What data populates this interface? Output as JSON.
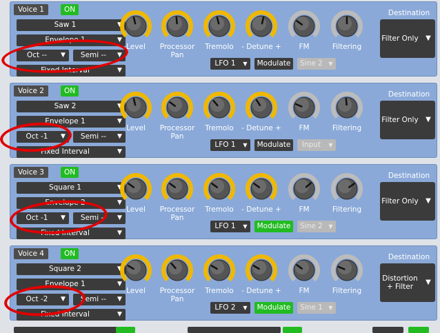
{
  "voices": [
    {
      "title": "Voice 1",
      "on": "ON",
      "wave": "Saw 1",
      "envelope": "Envelope 1",
      "oct": "Oct --",
      "semi": "Semi --",
      "interval": "Fixed Interval",
      "knobs": [
        {
          "label": "Level",
          "type": "gold",
          "level": 0.45
        },
        {
          "label": "Processor Pan",
          "type": "gold",
          "level": 0.48
        },
        {
          "label": "Tremolo",
          "type": "gold",
          "level": 0.45
        },
        {
          "label": "- Detune +",
          "type": "gold",
          "level": 0.55
        },
        {
          "label": "FM",
          "type": "grey",
          "level": 0.3
        },
        {
          "label": "Filtering",
          "type": "grey",
          "level": 0.5
        }
      ],
      "lfo": "LFO 1",
      "modulate": "Modulate",
      "modulate_active": false,
      "fm_source": "Sine 2",
      "destination_title": "Destination",
      "destination": "Filter Only"
    },
    {
      "title": "Voice 2",
      "on": "ON",
      "wave": "Saw 2",
      "envelope": "Envelope 1",
      "oct": "Oct -1",
      "semi": "Semi --",
      "interval": "Fixed Interval",
      "knobs": [
        {
          "label": "Level",
          "type": "gold",
          "level": 0.45
        },
        {
          "label": "Processor Pan",
          "type": "gold",
          "level": 0.3
        },
        {
          "label": "Tremolo",
          "type": "gold",
          "level": 0.35
        },
        {
          "label": "- Detune +",
          "type": "gold",
          "level": 0.38
        },
        {
          "label": "FM",
          "type": "grey",
          "level": 0.25
        },
        {
          "label": "Filtering",
          "type": "grey",
          "level": 0.48
        }
      ],
      "lfo": "LFO 1",
      "modulate": "Modulate",
      "modulate_active": false,
      "fm_source": "Input",
      "destination_title": "Destination",
      "destination": "Filter Only"
    },
    {
      "title": "Voice 3",
      "on": "ON",
      "wave": "Square 1",
      "envelope": "Envelope 2",
      "oct": "Oct -1",
      "semi": "Semi --",
      "interval": "Fixed Interval",
      "knobs": [
        {
          "label": "Level",
          "type": "gold",
          "level": 0.3
        },
        {
          "label": "Processor Pan",
          "type": "gold",
          "level": 0.3
        },
        {
          "label": "Tremolo",
          "type": "gold",
          "level": 0.3
        },
        {
          "label": "- Detune +",
          "type": "gold",
          "level": 0.3
        },
        {
          "label": "FM",
          "type": "grey",
          "level": 0.68
        },
        {
          "label": "Filtering",
          "type": "grey",
          "level": 0.7
        }
      ],
      "lfo": "LFO 1",
      "modulate": "Modulate",
      "modulate_active": true,
      "fm_source": "Sine 2",
      "destination_title": "Destination",
      "destination": "Filter Only"
    },
    {
      "title": "Voice 4",
      "on": "ON",
      "wave": "Square 2",
      "envelope": "Envelope 1",
      "oct": "Oct -2",
      "semi": "Semi --",
      "interval": "Fixed Interval",
      "knobs": [
        {
          "label": "Level",
          "type": "gold",
          "level": 0.28
        },
        {
          "label": "Processor Pan",
          "type": "gold",
          "level": 0.35
        },
        {
          "label": "Tremolo",
          "type": "gold",
          "level": 0.28
        },
        {
          "label": "- Detune +",
          "type": "gold",
          "level": 0.28
        },
        {
          "label": "FM",
          "type": "grey",
          "level": 0.3
        },
        {
          "label": "Filtering",
          "type": "grey",
          "level": 0.25
        }
      ],
      "lfo": "LFO 2",
      "modulate": "Modulate",
      "modulate_active": true,
      "fm_source": "Sine 1",
      "destination_title": "Destination",
      "destination": "Distortion + Filter"
    }
  ],
  "colors": {
    "panel": "#8aa9d8",
    "on_green": "#22bb22",
    "knob_gold": "#f0b800",
    "knob_grey": "#bcbcbc",
    "annotation_red": "#e00000"
  },
  "icons": {
    "dropdown": "triangle-down-icon"
  },
  "glyphs": {
    "dropdown_arrow": "▼"
  }
}
